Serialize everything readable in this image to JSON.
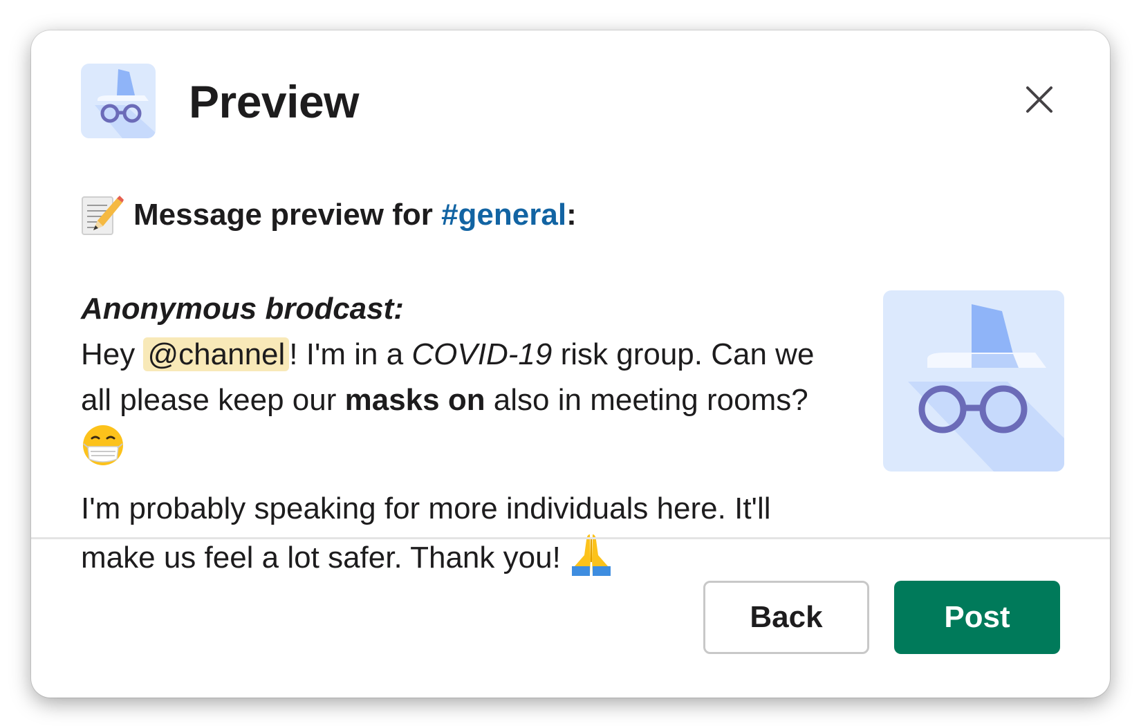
{
  "modal": {
    "title": "Preview",
    "close_icon": "close-icon",
    "app_icon": "incognito-hat-glasses-icon"
  },
  "preview": {
    "memo_icon": "memo-pencil-icon",
    "heading_prefix": "Message preview for ",
    "channel": "#general",
    "heading_suffix": ":"
  },
  "message": {
    "lead": "Anonymous brodcast:",
    "p1_hey": "Hey ",
    "mention": "@channel",
    "p1_a": "! I'm in a ",
    "p1_covid": "COVID-19",
    "p1_b": " risk group. Can we all please keep our ",
    "p1_bold": "masks on",
    "p1_c": " also in meeting rooms? ",
    "mask_emoji": "face-with-medical-mask-emoji",
    "p2": "I'm probably speaking for more individuals here. It'll make us feel a lot safer. Thank you! ",
    "pray_emoji": "folded-hands-emoji"
  },
  "footer": {
    "back_label": "Back",
    "post_label": "Post"
  },
  "colors": {
    "channel_link": "#1264a3",
    "mention_bg": "#f8e9b8",
    "post_button": "#007a5a",
    "icon_bg": "#dce9fd",
    "hat": "#8fb4f8",
    "glasses": "#6b6bb8"
  }
}
